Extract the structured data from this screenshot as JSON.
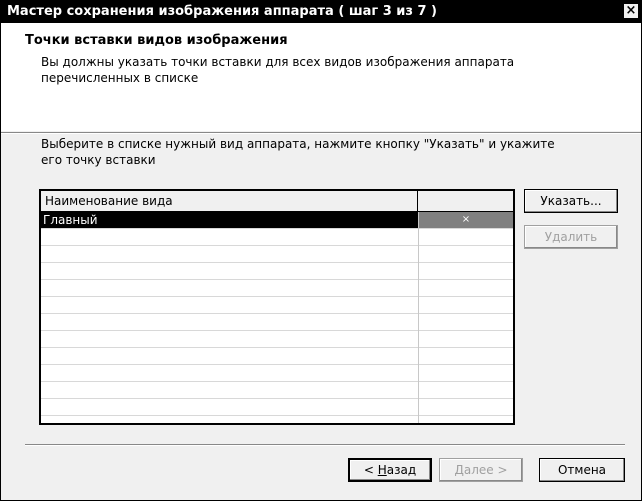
{
  "window": {
    "title": "Мастер сохранения изображения аппарата ( шаг 3 из 7 )",
    "close_symbol": "×"
  },
  "header": {
    "heading": "Точки вставки видов изображения",
    "description_line1": "Вы должны указать точки вставки для всех видов изображения аппарата",
    "description_line2": "перечисленных в списке"
  },
  "instruction": {
    "line1": "Выберите в списке нужный вид аппарата, нажмите кнопку \"Указать\" и укажите",
    "line2": "его точку вставки"
  },
  "list": {
    "column_name_header": "Наименование вида",
    "column_mark_header": "",
    "rows": [
      {
        "name": "Главный",
        "mark": "×",
        "selected": true
      }
    ]
  },
  "side_buttons": {
    "specify": "Указать...",
    "delete": "Удалить"
  },
  "footer": {
    "back_accel": "Н",
    "back_rest": "азад",
    "back_prefix": "< ",
    "next": "Далее >",
    "cancel": "Отмена"
  }
}
